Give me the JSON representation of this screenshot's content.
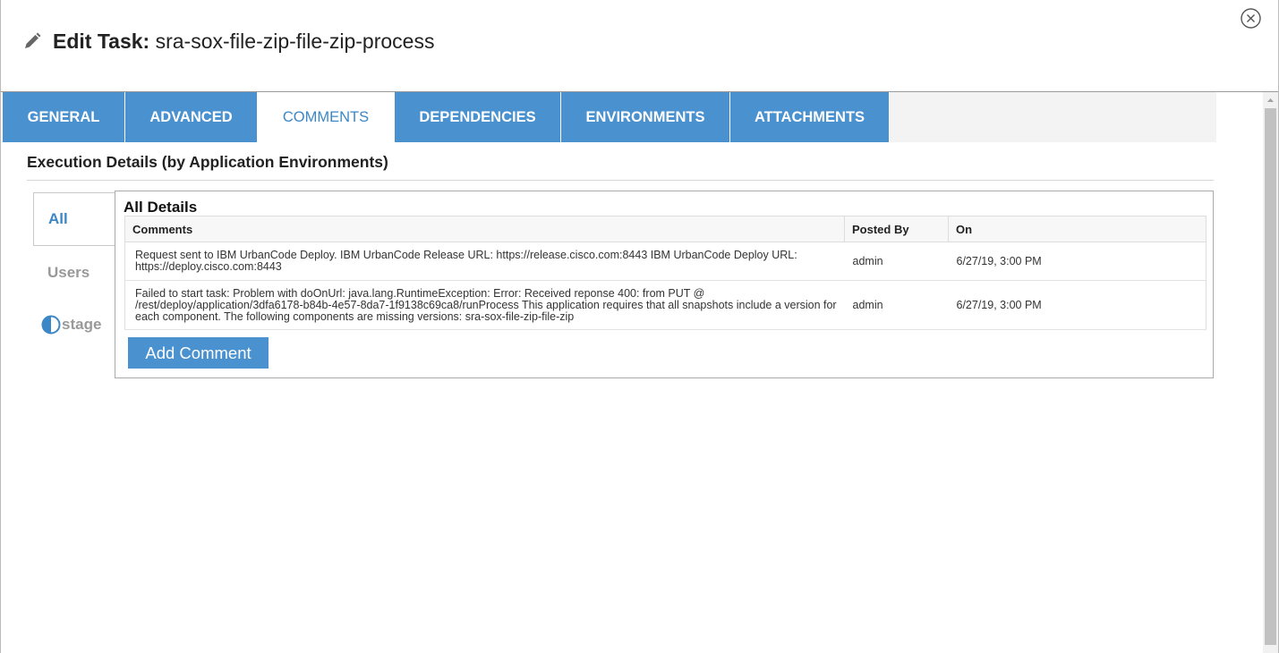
{
  "dialog": {
    "title_label": "Edit Task:",
    "title_value": "sra-sox-file-zip-file-zip-process",
    "icons": {
      "edit": "pencil-icon",
      "close": "close-circle-icon"
    }
  },
  "tabs": [
    {
      "label": "GENERAL",
      "active": false
    },
    {
      "label": "ADVANCED",
      "active": false
    },
    {
      "label": "COMMENTS",
      "active": true
    },
    {
      "label": "DEPENDENCIES",
      "active": false
    },
    {
      "label": "ENVIRONMENTS",
      "active": false
    },
    {
      "label": "ATTACHMENTS",
      "active": false
    }
  ],
  "section": {
    "heading": "Execution Details (by Application Environments)"
  },
  "filters": [
    {
      "label": "All",
      "active": true
    },
    {
      "label": "Users",
      "active": false
    },
    {
      "label": "stage",
      "active": false,
      "icon": "half-circle-icon"
    }
  ],
  "panel": {
    "title": "All Details",
    "columns": [
      "Comments",
      "Posted By",
      "On"
    ],
    "rows": [
      {
        "comment": "Request sent to IBM UrbanCode Deploy. IBM UrbanCode Release URL: https://release.cisco.com:8443 IBM UrbanCode Deploy URL: https://deploy.cisco.com:8443",
        "posted_by": "admin",
        "on": "6/27/19, 3:00 PM"
      },
      {
        "comment": "Failed to start task: Problem with doOnUrl: java.lang.RuntimeException: Error: Received reponse 400: from PUT @ /rest/deploy/application/3dfa6178-b84b-4e57-8da7-1f9138c69ca8/runProcess This application requires that all snapshots include a version for each component. The following components are missing versions: sra-sox-file-zip-file-zip",
        "posted_by": "admin",
        "on": "6/27/19, 3:00 PM"
      }
    ],
    "add_button": "Add Comment"
  },
  "colors": {
    "accent": "#4a91cf",
    "active_tab_text": "#3c87c6"
  }
}
